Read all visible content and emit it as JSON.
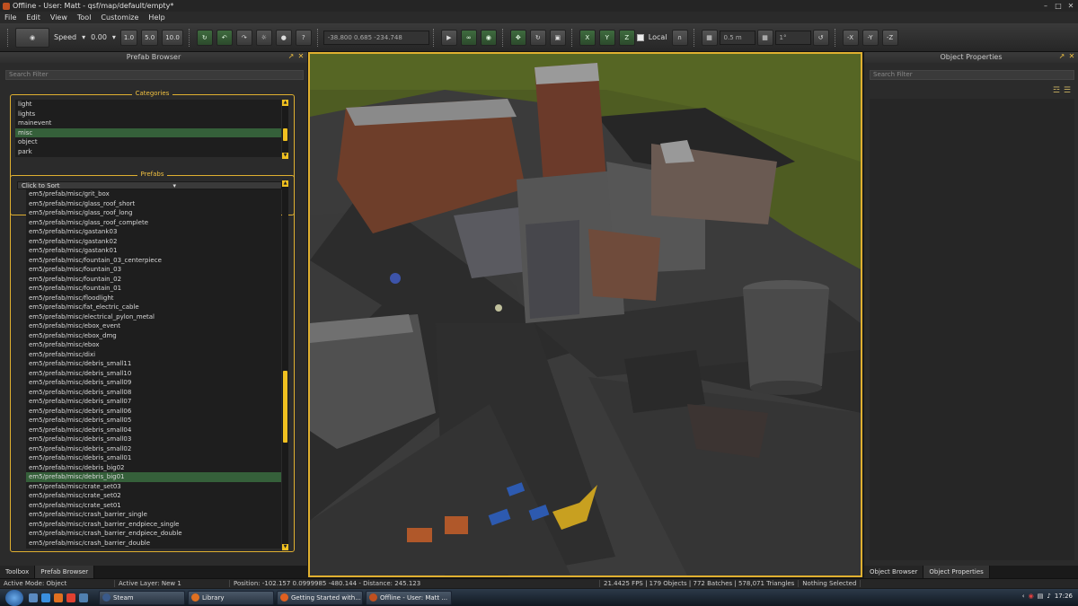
{
  "window": {
    "title": "Offline - User: Matt - qsf/map/default/empty*",
    "minimize": "–",
    "maximize": "□",
    "close": "✕"
  },
  "menu": [
    "File",
    "Edit",
    "View",
    "Tool",
    "Customize",
    "Help"
  ],
  "toolbar": {
    "speed_label": "Speed",
    "speed_value": "0.00",
    "speed_presets": [
      "1.0",
      "5.0",
      "10.0"
    ],
    "help_btn": "?",
    "coords": "-38.800 0.685 -234.748",
    "axes": [
      "X",
      "Y",
      "Z"
    ],
    "local_label": "Local",
    "grid_size": "0.5 m",
    "angle_snap": "1°",
    "neg_axes": [
      "-X",
      "-Y",
      "-Z"
    ]
  },
  "prefab_browser": {
    "title": "Prefab Browser",
    "search_placeholder": "Search Filter",
    "categories_title": "Categories",
    "categories": [
      {
        "label": "light"
      },
      {
        "label": "lights"
      },
      {
        "label": "mainevent"
      },
      {
        "label": "misc",
        "selected": true
      },
      {
        "label": "object"
      },
      {
        "label": "park"
      }
    ],
    "prefabs_title": "Prefabs",
    "sort_label": "Click to Sort",
    "prefabs": [
      {
        "label": "em5/prefab/misc/grit_box"
      },
      {
        "label": "em5/prefab/misc/glass_roof_short"
      },
      {
        "label": "em5/prefab/misc/glass_roof_long"
      },
      {
        "label": "em5/prefab/misc/glass_roof_complete"
      },
      {
        "label": "em5/prefab/misc/gastank03"
      },
      {
        "label": "em5/prefab/misc/gastank02"
      },
      {
        "label": "em5/prefab/misc/gastank01"
      },
      {
        "label": "em5/prefab/misc/fountain_03_centerpiece"
      },
      {
        "label": "em5/prefab/misc/fountain_03"
      },
      {
        "label": "em5/prefab/misc/fountain_02"
      },
      {
        "label": "em5/prefab/misc/fountain_01"
      },
      {
        "label": "em5/prefab/misc/floodlight"
      },
      {
        "label": "em5/prefab/misc/fat_electric_cable"
      },
      {
        "label": "em5/prefab/misc/electrical_pylon_metal"
      },
      {
        "label": "em5/prefab/misc/ebox_event"
      },
      {
        "label": "em5/prefab/misc/ebox_dmg"
      },
      {
        "label": "em5/prefab/misc/ebox"
      },
      {
        "label": "em5/prefab/misc/dixi"
      },
      {
        "label": "em5/prefab/misc/debris_small11"
      },
      {
        "label": "em5/prefab/misc/debris_small10"
      },
      {
        "label": "em5/prefab/misc/debris_small09"
      },
      {
        "label": "em5/prefab/misc/debris_small08"
      },
      {
        "label": "em5/prefab/misc/debris_small07"
      },
      {
        "label": "em5/prefab/misc/debris_small06"
      },
      {
        "label": "em5/prefab/misc/debris_small05"
      },
      {
        "label": "em5/prefab/misc/debris_small04"
      },
      {
        "label": "em5/prefab/misc/debris_small03"
      },
      {
        "label": "em5/prefab/misc/debris_small02"
      },
      {
        "label": "em5/prefab/misc/debris_small01"
      },
      {
        "label": "em5/prefab/misc/debris_big02"
      },
      {
        "label": "em5/prefab/misc/debris_big01",
        "selected": true
      },
      {
        "label": "em5/prefab/misc/crate_set03"
      },
      {
        "label": "em5/prefab/misc/crate_set02"
      },
      {
        "label": "em5/prefab/misc/crate_set01"
      },
      {
        "label": "em5/prefab/misc/crash_barrier_single"
      },
      {
        "label": "em5/prefab/misc/crash_barrier_endpiece_single"
      },
      {
        "label": "em5/prefab/misc/crash_barrier_endpiece_double"
      },
      {
        "label": "em5/prefab/misc/crash_barrier_double"
      }
    ],
    "tabs": [
      "Toolbox",
      "Prefab Browser"
    ]
  },
  "object_properties": {
    "title": "Object Properties",
    "search_placeholder": "Search Filter",
    "tabs": [
      "Object Browser",
      "Object Properties"
    ]
  },
  "status": {
    "mode": "Active Mode: Object",
    "layer": "Active Layer: New 1",
    "position": "Position: -102.157 0.0999985 -480.144 - Distance: 245.123",
    "stats": "21.4425 FPS | 179 Objects | 772 Batches | 578,071 Triangles",
    "selection": "Nothing Selected"
  },
  "taskbar": {
    "tasks": [
      {
        "label": "Steam",
        "color": "#3a5a8a"
      },
      {
        "label": "Library",
        "color": "#e07020"
      },
      {
        "label": "Getting Started with...",
        "color": "#e06020"
      },
      {
        "label": "Offline - User: Matt ...",
        "color": "#c05020"
      }
    ],
    "tray_arrow": "‹",
    "time": "17:26"
  }
}
